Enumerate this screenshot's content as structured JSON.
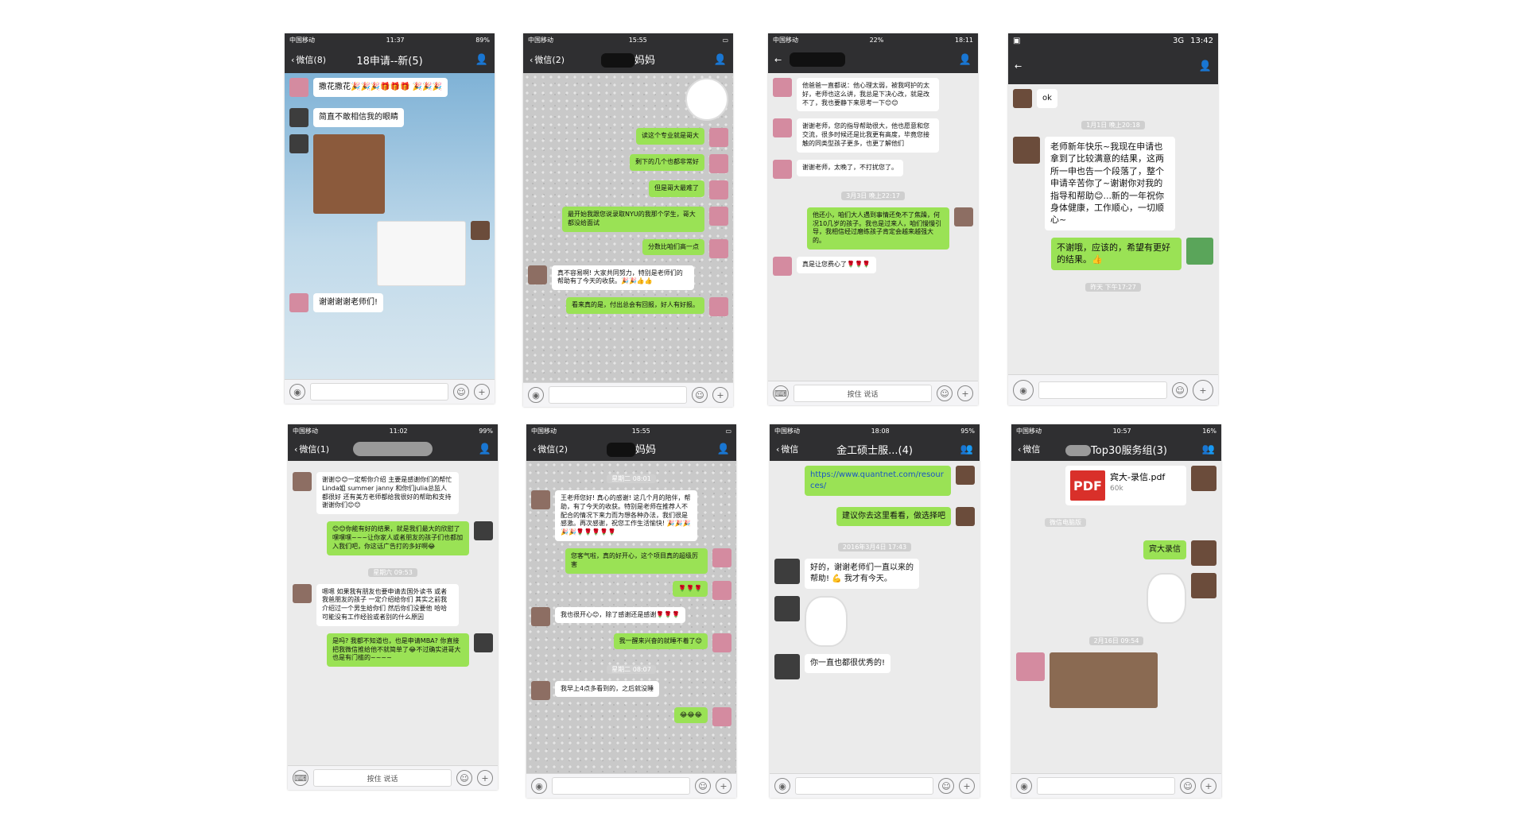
{
  "phones": [
    {
      "status": {
        "carrier": "中国移动",
        "time": "11:37",
        "battery": "89%"
      },
      "nav": {
        "back": "微信(8)",
        "title": "18申请--新(5)"
      },
      "messages": [
        {
          "text": "撒花撒花🎉🎉🎉🎁🎁🎁 🎉🎉🎉"
        },
        {
          "text": "简直不敢相信我的眼睛"
        },
        {
          "text": "谢谢谢谢老师们!"
        }
      ]
    },
    {
      "status": {
        "carrier": "中国移动",
        "time": "15:55"
      },
      "nav": {
        "back": "微信(2)",
        "title": "妈妈"
      },
      "messages": [
        {
          "text": "读这个专业就是哥大"
        },
        {
          "text": "剩下的几个也都非常好"
        },
        {
          "text": "但是哥大最难了"
        },
        {
          "text": "最开始我跟您说录取NYU的我那个学生，哥大都没给面试"
        },
        {
          "text": "分数比咱们高一点"
        },
        {
          "text": "真不容易啊! 大家共同努力，特别是老师们的帮助有了今天的收获。🎉🎉👍👍"
        },
        {
          "text": "看来真的是，付出总会有回报，好人有好报。"
        }
      ]
    },
    {
      "status": {
        "carrier": "中国移动",
        "time": "18:11",
        "battery": "22%"
      },
      "nav": {
        "title": ""
      },
      "messages": [
        {
          "text": "他爸爸一直都说：他心理太弱，被我呵护的太好，老师也这么讲，我总是下决心改，就是改不了，我也要静下来思考一下😊😊"
        },
        {
          "text": "谢谢老师，您的指导帮助很大，他也愿意和您交流，很多时候还是比我更有高度，毕竟您接触的同类型孩子更多，也更了解他们"
        },
        {
          "text": "谢谢老师，太晚了，不打扰您了。"
        },
        {
          "time": "3月3日 晚上22:17"
        },
        {
          "text": "他还小，咱们大人遇到事情还免不了焦躁，何况10几岁的孩子。我也是过来人，咱们慢慢引导，我相信经过磨练孩子肯定会越来越强大的。"
        },
        {
          "text": "真是让您费心了🌹🌹🌹"
        }
      ],
      "input": {
        "hold": "按住 说话"
      }
    },
    {
      "status": {
        "network": "3G",
        "time": "13:42"
      },
      "nav": {
        "title": ""
      },
      "messages": [
        {
          "text": "ok"
        },
        {
          "time": "1月1日 晚上20:18"
        },
        {
          "text": "老师新年快乐~我现在申请也拿到了比较满意的结果，这两所一申也告一个段落了，整个申请辛苦你了~谢谢你对我的指导和帮助😊...新的一年祝你身体健康，工作顺心，一切顺心~"
        },
        {
          "text": "不谢哦，应该的，希望有更好的结果。👍"
        },
        {
          "time": "昨天 下午17:27"
        }
      ]
    },
    {
      "status": {
        "carrier": "中国移动",
        "time": "11:02",
        "battery": "99%"
      },
      "nav": {
        "back": "微信(1)",
        "title": ""
      },
      "messages": [
        {
          "text": "谢谢😊😊一定帮你介绍 主要是感谢你们的帮忙 Linda姐 summer janny 和你们julia总监人都很好 还有美方老师都给我很好的帮助和支持 谢谢你们😊😊"
        },
        {
          "text": "😊😊你能有好的结果，就是我们最大的欣慰了嘿嘿嘿~~~让你家人或者朋友的孩子们也都加入我们吧，你这话广告打的多好啊😂"
        },
        {
          "time": "星期六 09:53"
        },
        {
          "text": "嗯嗯 如果我有朋友也要申请去国外读书 或者我爸朋友的孩子 一定介绍给你们 其实之前我介绍过一个男生给你们 然后你们没要他 哈哈 可能没有工作经验或者别的什么原因"
        },
        {
          "text": "是吗? 我都不知道也，也是申请MBA? 你直接把我微信推给他不就简单了😂不过确实进哥大也是有门槛的~~~~"
        }
      ],
      "input": {
        "hold": "按住 说话"
      }
    },
    {
      "status": {
        "carrier": "中国移动",
        "time": "15:55"
      },
      "nav": {
        "back": "微信(2)",
        "title": "妈妈"
      },
      "messages": [
        {
          "time": "星期二 08:01"
        },
        {
          "text": "王老师您好! 真心的感谢! 这几个月的陪伴，帮助，有了今天的收获。特别是老师在推荐人不配合的情况下来力而为想各种办法，我们很是感激。再次感谢，祝您工作生活愉快! 🎉🎉🎉🎉🎉🌹🌹🌹🌹🌹"
        },
        {
          "text": "您客气啦，真的好开心，这个项目真的超级厉害"
        },
        {
          "text": "🌹🌹🌹"
        },
        {
          "text": "我也很开心😊，除了感谢还是感谢🌹🌹🌹"
        },
        {
          "text": "我一醒来兴奋的就睡不着了😊"
        },
        {
          "time": "星期二 08:07"
        },
        {
          "text": "我早上4点多看到的，之后就没睡"
        },
        {
          "text": "😂😂😂"
        }
      ]
    },
    {
      "status": {
        "carrier": "中国移动",
        "time": "18:08",
        "battery": "95%"
      },
      "nav": {
        "back": "微信",
        "title": "金工硕士服...(4)"
      },
      "messages": [
        {
          "text": "https://www.quantnet.com/resources/"
        },
        {
          "text": "建议你去这里看看，做选择吧"
        },
        {
          "time": "2016年3月4日 17:43"
        },
        {
          "text": "好的，谢谢老师们一直以来的帮助! 💪 我才有今天。"
        },
        {
          "text": "你一直也都很优秀的!"
        }
      ]
    },
    {
      "status": {
        "carrier": "中国移动",
        "time": "10:57",
        "battery": "16%"
      },
      "nav": {
        "back": "微信",
        "title": "Top30服务组(3)"
      },
      "messages": [
        {
          "file": "宾大-录信.pdf",
          "size": "60k",
          "pdf": "PDF",
          "source": "微信电脑版"
        },
        {
          "text": "宾大录信"
        },
        {
          "time": "2月16日 09:54"
        }
      ]
    }
  ]
}
